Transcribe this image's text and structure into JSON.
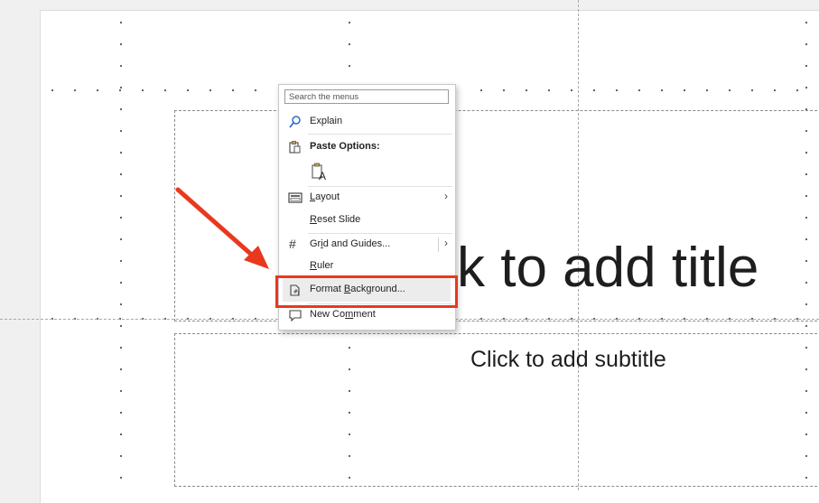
{
  "slide": {
    "title_placeholder": "k to add title",
    "subtitle_placeholder": "Click to add subtitle"
  },
  "context_menu": {
    "search_placeholder": "Search the menus",
    "items": [
      {
        "label": "Explain",
        "icon": "explain-icon"
      },
      {
        "label": "Paste Options:",
        "icon": "paste-icon"
      },
      {
        "label": "A",
        "icon": "paste-keep-text-icon"
      },
      {
        "label": "Layout",
        "icon": "layout-icon",
        "submenu": true
      },
      {
        "label": "Reset Slide"
      },
      {
        "label": "Grid and Guides...",
        "icon": "grid-icon",
        "submenu": true
      },
      {
        "label": "Ruler"
      },
      {
        "label": "Format Background...",
        "icon": "format-background-icon",
        "highlighted": true
      },
      {
        "label": "New Comment",
        "icon": "comment-icon"
      }
    ]
  },
  "colors": {
    "annotation": "#e8391f",
    "accent_icon": "#2b6cc4"
  }
}
